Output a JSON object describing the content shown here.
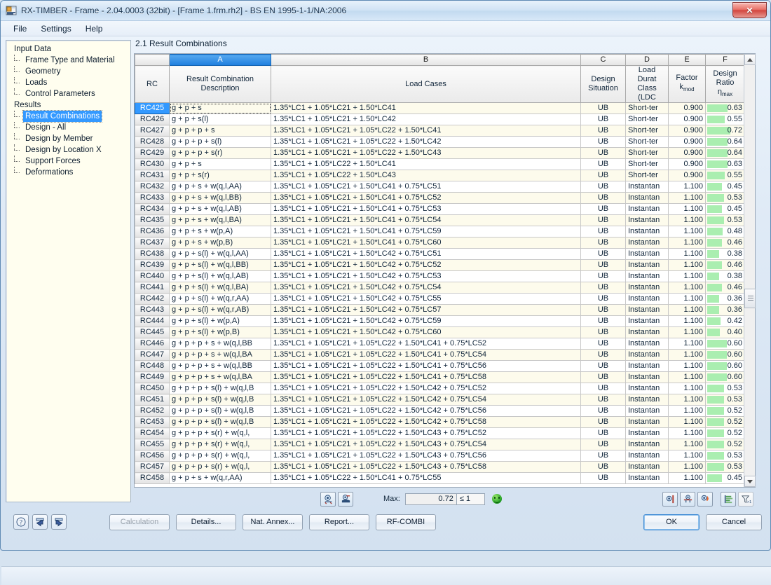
{
  "window": {
    "title": "RX-TIMBER - Frame - 2.04.0003 (32bit) - [Frame 1.frm.rh2] - BS EN 1995-1-1/NA:2006",
    "close_label": "✕"
  },
  "menu": {
    "items": [
      "File",
      "Settings",
      "Help"
    ]
  },
  "tree": {
    "groups": [
      {
        "label": "Input Data",
        "children": [
          "Frame Type and Material",
          "Geometry",
          "Loads",
          "Control Parameters"
        ]
      },
      {
        "label": "Results",
        "children": [
          "Result Combinations",
          "Design - All",
          "Design by Member",
          "Design by Location X",
          "Support Forces",
          "Deformations"
        ]
      }
    ],
    "selected": "Result Combinations"
  },
  "panel": {
    "title": "2.1 Result Combinations"
  },
  "table": {
    "column_letters": [
      "",
      "A",
      "B",
      "C",
      "D",
      "E",
      "F"
    ],
    "selected_column": "A",
    "headers": {
      "rc": "RC",
      "a": [
        "Result Combination",
        "Description"
      ],
      "b": [
        "",
        "Load Cases"
      ],
      "c": [
        "Design",
        "Situation"
      ],
      "d": [
        "Load Durat",
        "Class (LDC"
      ],
      "e": [
        "Factor",
        "k mod"
      ],
      "f": [
        "Design",
        "Ratio η max"
      ]
    },
    "selected_row": "RC425",
    "rows": [
      {
        "rc": "RC425",
        "desc": "g + p + s",
        "loads": "1.35*LC1 + 1.05*LC21 + 1.50*LC41",
        "ds": "UB",
        "ldc": "Short-ter",
        "kmod": "0.900",
        "ratio": "0.63"
      },
      {
        "rc": "RC426",
        "desc": "g + p + s(l)",
        "loads": "1.35*LC1 + 1.05*LC21 + 1.50*LC42",
        "ds": "UB",
        "ldc": "Short-ter",
        "kmod": "0.900",
        "ratio": "0.55"
      },
      {
        "rc": "RC427",
        "desc": "g + p + p + s",
        "loads": "1.35*LC1 + 1.05*LC21 + 1.05*LC22 + 1.50*LC41",
        "ds": "UB",
        "ldc": "Short-ter",
        "kmod": "0.900",
        "ratio": "0.72"
      },
      {
        "rc": "RC428",
        "desc": "g + p + p + s(l)",
        "loads": "1.35*LC1 + 1.05*LC21 + 1.05*LC22 + 1.50*LC42",
        "ds": "UB",
        "ldc": "Short-ter",
        "kmod": "0.900",
        "ratio": "0.64"
      },
      {
        "rc": "RC429",
        "desc": "g + p + p + s(r)",
        "loads": "1.35*LC1 + 1.05*LC21 + 1.05*LC22 + 1.50*LC43",
        "ds": "UB",
        "ldc": "Short-ter",
        "kmod": "0.900",
        "ratio": "0.64"
      },
      {
        "rc": "RC430",
        "desc": "g + p + s",
        "loads": "1.35*LC1 + 1.05*LC22 + 1.50*LC41",
        "ds": "UB",
        "ldc": "Short-ter",
        "kmod": "0.900",
        "ratio": "0.63"
      },
      {
        "rc": "RC431",
        "desc": "g + p + s(r)",
        "loads": "1.35*LC1 + 1.05*LC22 + 1.50*LC43",
        "ds": "UB",
        "ldc": "Short-ter",
        "kmod": "0.900",
        "ratio": "0.55"
      },
      {
        "rc": "RC432",
        "desc": "g + p + s + w(q,l,AA)",
        "loads": "1.35*LC1 + 1.05*LC21 + 1.50*LC41 + 0.75*LC51",
        "ds": "UB",
        "ldc": "Instantan",
        "kmod": "1.100",
        "ratio": "0.45"
      },
      {
        "rc": "RC433",
        "desc": "g + p + s + w(q,l,BB)",
        "loads": "1.35*LC1 + 1.05*LC21 + 1.50*LC41 + 0.75*LC52",
        "ds": "UB",
        "ldc": "Instantan",
        "kmod": "1.100",
        "ratio": "0.53"
      },
      {
        "rc": "RC434",
        "desc": "g + p + s + w(q,l,AB)",
        "loads": "1.35*LC1 + 1.05*LC21 + 1.50*LC41 + 0.75*LC53",
        "ds": "UB",
        "ldc": "Instantan",
        "kmod": "1.100",
        "ratio": "0.45"
      },
      {
        "rc": "RC435",
        "desc": "g + p + s + w(q,l,BA)",
        "loads": "1.35*LC1 + 1.05*LC21 + 1.50*LC41 + 0.75*LC54",
        "ds": "UB",
        "ldc": "Instantan",
        "kmod": "1.100",
        "ratio": "0.53"
      },
      {
        "rc": "RC436",
        "desc": "g + p + s + w(p,A)",
        "loads": "1.35*LC1 + 1.05*LC21 + 1.50*LC41 + 0.75*LC59",
        "ds": "UB",
        "ldc": "Instantan",
        "kmod": "1.100",
        "ratio": "0.48"
      },
      {
        "rc": "RC437",
        "desc": "g + p + s + w(p,B)",
        "loads": "1.35*LC1 + 1.05*LC21 + 1.50*LC41 + 0.75*LC60",
        "ds": "UB",
        "ldc": "Instantan",
        "kmod": "1.100",
        "ratio": "0.46"
      },
      {
        "rc": "RC438",
        "desc": "g + p + s(l) + w(q,l,AA)",
        "loads": "1.35*LC1 + 1.05*LC21 + 1.50*LC42 + 0.75*LC51",
        "ds": "UB",
        "ldc": "Instantan",
        "kmod": "1.100",
        "ratio": "0.38"
      },
      {
        "rc": "RC439",
        "desc": "g + p + s(l) + w(q,l,BB)",
        "loads": "1.35*LC1 + 1.05*LC21 + 1.50*LC42 + 0.75*LC52",
        "ds": "UB",
        "ldc": "Instantan",
        "kmod": "1.100",
        "ratio": "0.46"
      },
      {
        "rc": "RC440",
        "desc": "g + p + s(l) + w(q,l,AB)",
        "loads": "1.35*LC1 + 1.05*LC21 + 1.50*LC42 + 0.75*LC53",
        "ds": "UB",
        "ldc": "Instantan",
        "kmod": "1.100",
        "ratio": "0.38"
      },
      {
        "rc": "RC441",
        "desc": "g + p + s(l) + w(q,l,BA)",
        "loads": "1.35*LC1 + 1.05*LC21 + 1.50*LC42 + 0.75*LC54",
        "ds": "UB",
        "ldc": "Instantan",
        "kmod": "1.100",
        "ratio": "0.46"
      },
      {
        "rc": "RC442",
        "desc": "g + p + s(l) + w(q,r,AA)",
        "loads": "1.35*LC1 + 1.05*LC21 + 1.50*LC42 + 0.75*LC55",
        "ds": "UB",
        "ldc": "Instantan",
        "kmod": "1.100",
        "ratio": "0.36"
      },
      {
        "rc": "RC443",
        "desc": "g + p + s(l) + w(q,r,AB)",
        "loads": "1.35*LC1 + 1.05*LC21 + 1.50*LC42 + 0.75*LC57",
        "ds": "UB",
        "ldc": "Instantan",
        "kmod": "1.100",
        "ratio": "0.36"
      },
      {
        "rc": "RC444",
        "desc": "g + p + s(l) + w(p,A)",
        "loads": "1.35*LC1 + 1.05*LC21 + 1.50*LC42 + 0.75*LC59",
        "ds": "UB",
        "ldc": "Instantan",
        "kmod": "1.100",
        "ratio": "0.42"
      },
      {
        "rc": "RC445",
        "desc": "g + p + s(l) + w(p,B)",
        "loads": "1.35*LC1 + 1.05*LC21 + 1.50*LC42 + 0.75*LC60",
        "ds": "UB",
        "ldc": "Instantan",
        "kmod": "1.100",
        "ratio": "0.40"
      },
      {
        "rc": "RC446",
        "desc": "g + p + p + s + w(q,l,BB",
        "loads": "1.35*LC1 + 1.05*LC21 + 1.05*LC22 + 1.50*LC41 + 0.75*LC52",
        "ds": "UB",
        "ldc": "Instantan",
        "kmod": "1.100",
        "ratio": "0.60"
      },
      {
        "rc": "RC447",
        "desc": "g + p + p + s + w(q,l,BA",
        "loads": "1.35*LC1 + 1.05*LC21 + 1.05*LC22 + 1.50*LC41 + 0.75*LC54",
        "ds": "UB",
        "ldc": "Instantan",
        "kmod": "1.100",
        "ratio": "0.60"
      },
      {
        "rc": "RC448",
        "desc": "g + p + p + s + w(q,l,BB",
        "loads": "1.35*LC1 + 1.05*LC21 + 1.05*LC22 + 1.50*LC41 + 0.75*LC56",
        "ds": "UB",
        "ldc": "Instantan",
        "kmod": "1.100",
        "ratio": "0.60"
      },
      {
        "rc": "RC449",
        "desc": "g + p + p + s + w(q,l,BA",
        "loads": "1.35*LC1 + 1.05*LC21 + 1.05*LC22 + 1.50*LC41 + 0.75*LC58",
        "ds": "UB",
        "ldc": "Instantan",
        "kmod": "1.100",
        "ratio": "0.60"
      },
      {
        "rc": "RC450",
        "desc": "g + p + p + s(l) + w(q,l,B",
        "loads": "1.35*LC1 + 1.05*LC21 + 1.05*LC22 + 1.50*LC42 + 0.75*LC52",
        "ds": "UB",
        "ldc": "Instantan",
        "kmod": "1.100",
        "ratio": "0.53"
      },
      {
        "rc": "RC451",
        "desc": "g + p + p + s(l) + w(q,l,B",
        "loads": "1.35*LC1 + 1.05*LC21 + 1.05*LC22 + 1.50*LC42 + 0.75*LC54",
        "ds": "UB",
        "ldc": "Instantan",
        "kmod": "1.100",
        "ratio": "0.53"
      },
      {
        "rc": "RC452",
        "desc": "g + p + p + s(l) + w(q,l,B",
        "loads": "1.35*LC1 + 1.05*LC21 + 1.05*LC22 + 1.50*LC42 + 0.75*LC56",
        "ds": "UB",
        "ldc": "Instantan",
        "kmod": "1.100",
        "ratio": "0.52"
      },
      {
        "rc": "RC453",
        "desc": "g + p + p + s(l) + w(q,l,B",
        "loads": "1.35*LC1 + 1.05*LC21 + 1.05*LC22 + 1.50*LC42 + 0.75*LC58",
        "ds": "UB",
        "ldc": "Instantan",
        "kmod": "1.100",
        "ratio": "0.52"
      },
      {
        "rc": "RC454",
        "desc": "g + p + p + s(r) + w(q,l,",
        "loads": "1.35*LC1 + 1.05*LC21 + 1.05*LC22 + 1.50*LC43 + 0.75*LC52",
        "ds": "UB",
        "ldc": "Instantan",
        "kmod": "1.100",
        "ratio": "0.52"
      },
      {
        "rc": "RC455",
        "desc": "g + p + p + s(r) + w(q,l,",
        "loads": "1.35*LC1 + 1.05*LC21 + 1.05*LC22 + 1.50*LC43 + 0.75*LC54",
        "ds": "UB",
        "ldc": "Instantan",
        "kmod": "1.100",
        "ratio": "0.52"
      },
      {
        "rc": "RC456",
        "desc": "g + p + p + s(r) + w(q,l,",
        "loads": "1.35*LC1 + 1.05*LC21 + 1.05*LC22 + 1.50*LC43 + 0.75*LC56",
        "ds": "UB",
        "ldc": "Instantan",
        "kmod": "1.100",
        "ratio": "0.53"
      },
      {
        "rc": "RC457",
        "desc": "g + p + p + s(r) + w(q,l,",
        "loads": "1.35*LC1 + 1.05*LC21 + 1.05*LC22 + 1.50*LC43 + 0.75*LC58",
        "ds": "UB",
        "ldc": "Instantan",
        "kmod": "1.100",
        "ratio": "0.53"
      },
      {
        "rc": "RC458",
        "desc": "g + p + s + w(q,r,AA)",
        "loads": "1.35*LC1 + 1.05*LC22 + 1.50*LC41 + 0.75*LC55",
        "ds": "UB",
        "ldc": "Instantan",
        "kmod": "1.100",
        "ratio": "0.45"
      }
    ]
  },
  "gridfooter": {
    "max_label": "Max:",
    "max_value": "0.72",
    "limit": "≤ 1",
    "status_icon": "green-smiley-icon"
  },
  "dialogfooter": {
    "buttons": [
      "Calculation",
      "Details...",
      "Nat. Annex...",
      "Report...",
      "RF-COMBI"
    ],
    "disabled": [
      "Calculation"
    ],
    "ok": "OK",
    "cancel": "Cancel"
  },
  "colors": {
    "accent": "#3399ff",
    "bar_green": "#aaeeb0",
    "row_alt": "#fdfbec"
  }
}
